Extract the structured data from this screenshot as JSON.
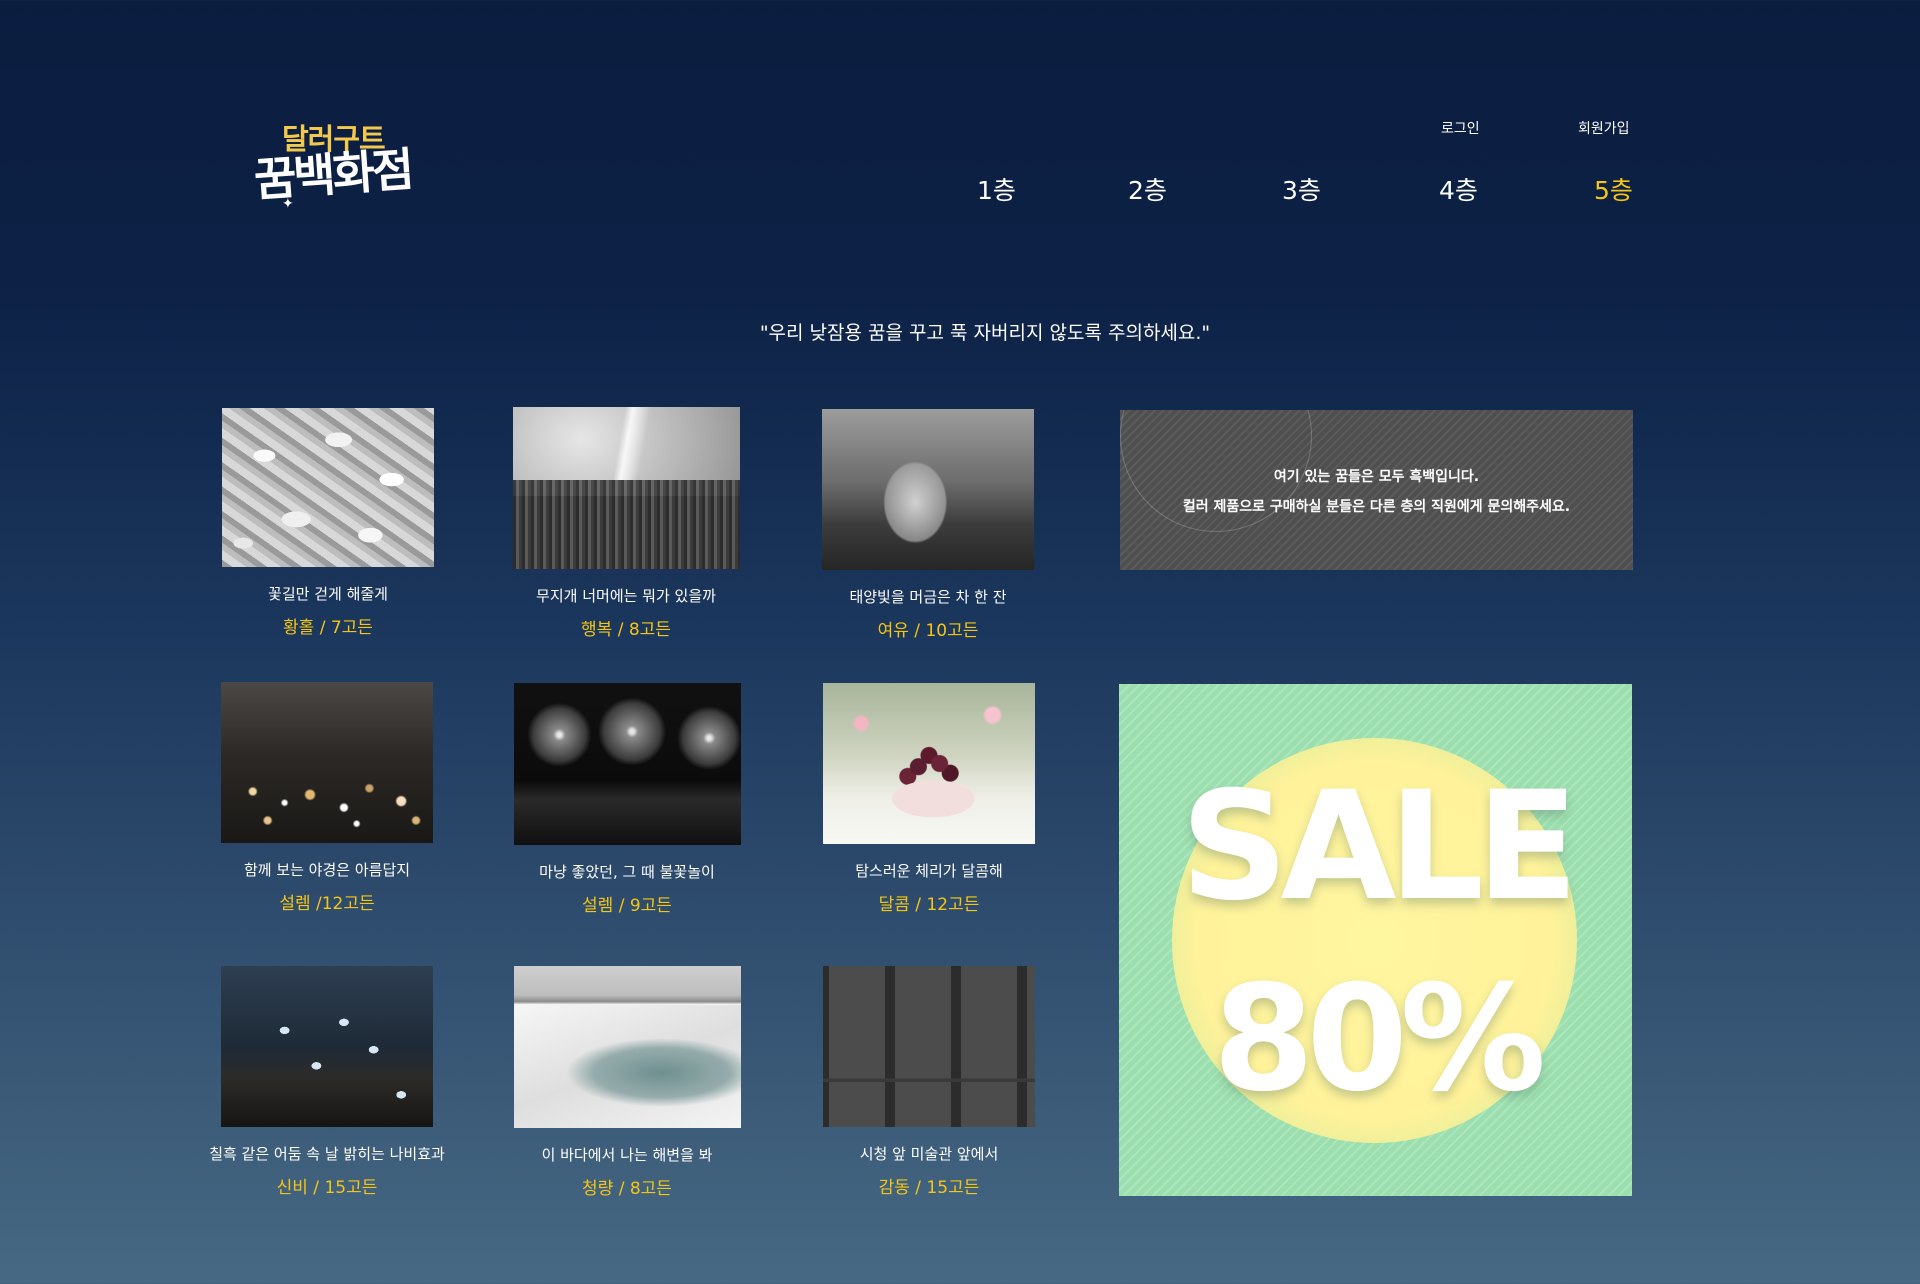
{
  "header": {
    "logo_top": "달러구트",
    "logo_bottom": "꿈백화점",
    "login": "로그인",
    "signup": "회원가입",
    "floors": [
      "1층",
      "2층",
      "3층",
      "4층",
      "5층"
    ],
    "active_floor": "5층"
  },
  "notice": "\"우리 낮잠용 꿈을 꾸고 푹 자버리지 않도록 주의하세요.\"",
  "products": [
    {
      "title": "꽃길만 걷게 해줄게",
      "price": "황홀 / 7고든",
      "image_icon": "petals-photo"
    },
    {
      "title": "무지개 너머에는 뭐가 있을까",
      "price": "행복 / 8고든",
      "image_icon": "rainbow-forest-photo"
    },
    {
      "title": "태양빛을 머금은 차 한 잔",
      "price": "여유 / 10고든",
      "image_icon": "tea-cup-photo"
    },
    {
      "title": "함께 보는 야경은 아름답지",
      "price": "설렘 /12고든",
      "image_icon": "night-city-photo"
    },
    {
      "title": "마냥 좋았던, 그 때 불꽃놀이",
      "price": "설렘 / 9고든",
      "image_icon": "fireworks-photo"
    },
    {
      "title": "탐스러운 체리가 달콤해",
      "price": "달콤 / 12고든",
      "image_icon": "cherry-bowl-photo"
    },
    {
      "title": "칠흑 같은 어둠 속 날 밝히는 나비효과",
      "price": "신비 / 15고든",
      "image_icon": "butterfly-photo"
    },
    {
      "title": "이 바다에서 나는 해변을 봐",
      "price": "청량 / 8고든",
      "image_icon": "sea-beach-photo"
    },
    {
      "title": "시청 앞 미술관 앞에서",
      "price": "감동 / 15고든",
      "image_icon": "museum-photo"
    }
  ],
  "info_banner": {
    "line1": "여기 있는 꿈들은 모두 흑백입니다.",
    "line2": "컬러 제품으로 구매하실 분들은 다른 층의 직원에게 문의해주세요."
  },
  "sale_banner": {
    "word": "SALE",
    "percent": "80%"
  },
  "colors": {
    "accent": "#f5c516",
    "background_top": "#0b1d3f",
    "background_bottom": "#476983",
    "sale_green": "#9bdfae",
    "sale_yellow": "#fff29a",
    "info_gray": "#4f4f4f"
  }
}
